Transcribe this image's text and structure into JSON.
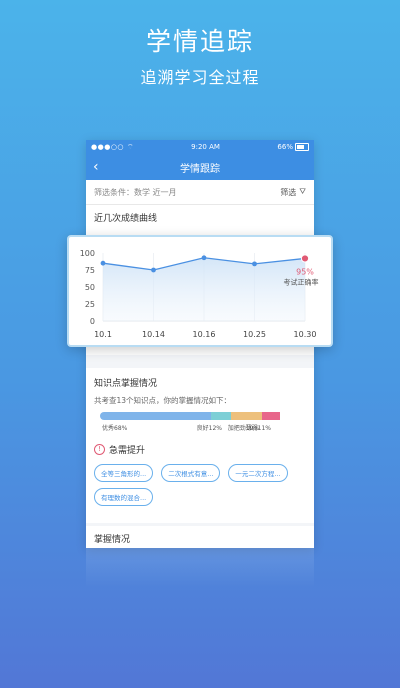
{
  "hero": {
    "title": "学情追踪",
    "subtitle": "追溯学习全过程"
  },
  "status_bar": {
    "signal": "●●●○○",
    "time": "9:20 AM",
    "battery": "66%"
  },
  "nav": {
    "title": "学情跟踪"
  },
  "filter": {
    "text": "筛选条件：数学 近一月",
    "button": "筛选"
  },
  "curve_section": {
    "title": "近几次成绩曲线"
  },
  "chart_data": {
    "type": "line",
    "x": [
      "10.1",
      "10.14",
      "10.16",
      "10.25",
      "10.30"
    ],
    "values": [
      85,
      75,
      93,
      84,
      92
    ],
    "ylim": [
      0,
      100
    ],
    "yticks": [
      0,
      25,
      50,
      75,
      100
    ],
    "annotation": {
      "value": "95%",
      "label": "考试正确率"
    },
    "color": "#4a90e2",
    "highlight_color": "#e05a74"
  },
  "knowledge": {
    "title": "知识点掌握情况",
    "desc": "共考查13个知识点，你的掌握情况如下：",
    "segments": [
      {
        "label": "优秀68%",
        "fraction": 0.5725,
        "color": "#7fb4ea"
      },
      {
        "label": "良好12%",
        "fraction": 0.1011,
        "color": "#7dcfd6"
      },
      {
        "label": "加把劲19%",
        "fraction": 0.16,
        "color": "#edc07c"
      },
      {
        "label": "薄弱11%",
        "fraction": 0.0926,
        "color": "#e8668a"
      }
    ]
  },
  "urgent": {
    "title": "急需提升",
    "tags": [
      "全等三角形的...",
      "二次根式有意...",
      "一元二次方程...",
      "有理数的混合..."
    ]
  },
  "mastery": {
    "title": "掌握情况"
  }
}
